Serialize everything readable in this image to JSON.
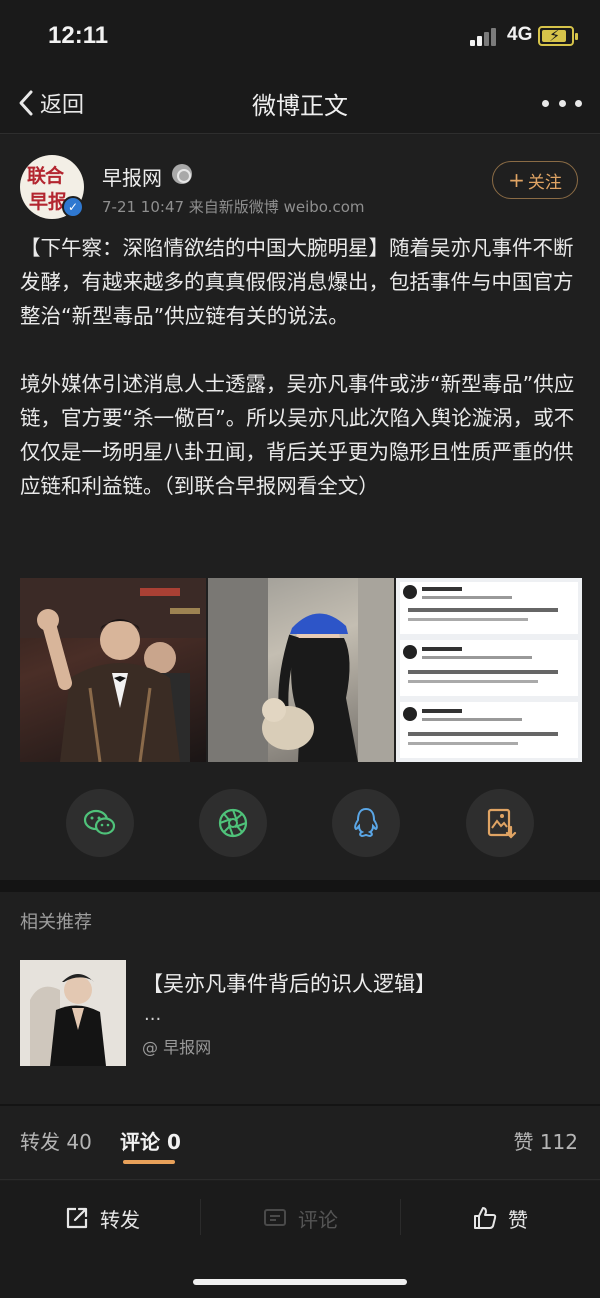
{
  "status_bar": {
    "time": "12:11",
    "network": "4G",
    "battery_charging": true
  },
  "nav": {
    "back_label": "返回",
    "title": "微博正文"
  },
  "post": {
    "author": "早报网",
    "avatar_text_line1": "联合",
    "avatar_text_line2": "早报",
    "meta": "7-21 10:47  来自新版微博 weibo.com",
    "follow_label": "关注",
    "paragraphs": [
      "【下午察：深陷情欲结的中国大腕明星】随着吴亦凡事件不断发酵，有越来越多的真真假假消息爆出，包括事件与中国官方整治“新型毒品”供应链有关的说法。",
      "境外媒体引述消息人士透露，吴亦凡事件或涉“新型毒品”供应链，官方要“杀一儆百”。所以吴亦凡此次陷入舆论漩涡，或不仅仅是一场明星八卦丑闻，背后关乎更为隐形且性质严重的供应链和利益链。（到联合早报网看全文）"
    ]
  },
  "share": {
    "items": [
      "wechat-icon",
      "moments-icon",
      "qq-icon",
      "save-image-icon"
    ]
  },
  "related": {
    "section_title": "相关推荐",
    "headline": "【吴亦凡事件背后的识人逻辑】",
    "ellipsis": "...",
    "source": "@ 早报网"
  },
  "tabs": {
    "repost_label": "转发 40",
    "comment_label": "评论 0",
    "like_label": "赞 112"
  },
  "actions": {
    "repost_label": "转发",
    "comment_label": "评论",
    "like_label": "赞"
  },
  "colors": {
    "background": "#1e1e1e",
    "accent": "#e0a464",
    "verified": "#2f78d0"
  }
}
